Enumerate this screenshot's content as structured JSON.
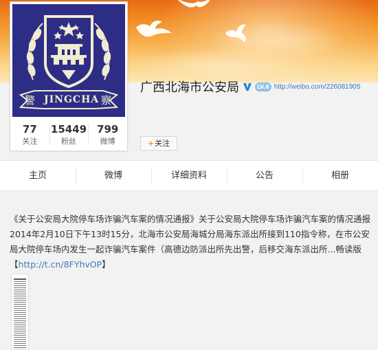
{
  "profile": {
    "name": "广西北海市公安局",
    "level": "LV.6",
    "url": "http://weibo.com/226081905",
    "avatar_text": "JINGCHA",
    "avatar_side_left": "警",
    "avatar_side_right": "察",
    "follow_label": "关注",
    "stats": [
      {
        "value": "77",
        "label": "关注"
      },
      {
        "value": "15449",
        "label": "粉丝"
      },
      {
        "value": "799",
        "label": "微博"
      }
    ]
  },
  "tabs": [
    {
      "label": "主页"
    },
    {
      "label": "微博"
    },
    {
      "label": "详细资料"
    },
    {
      "label": "公告"
    },
    {
      "label": "相册"
    }
  ],
  "post": {
    "text": "《关于公安局大院停车场诈骗汽车案的情况通报》关于公安局大院停车场诈骗汽车案的情况通报 2014年2月10日下午13时15分，北海市公安局海城分局海东派出所接到110指令称，在市公安局大院停车场内发生一起诈骗汽车案件（高德边防派出所先出警，后移交海东派出所...畅读版",
    "link_open": "【",
    "link": "http://t.cn/8FYhvOP",
    "link_close": "】"
  },
  "colors": {
    "avatar_bg": "#2e2d86",
    "link": "#3b79b4",
    "cover_top": "#e86a14",
    "cover_bottom": "#fde6b4"
  }
}
